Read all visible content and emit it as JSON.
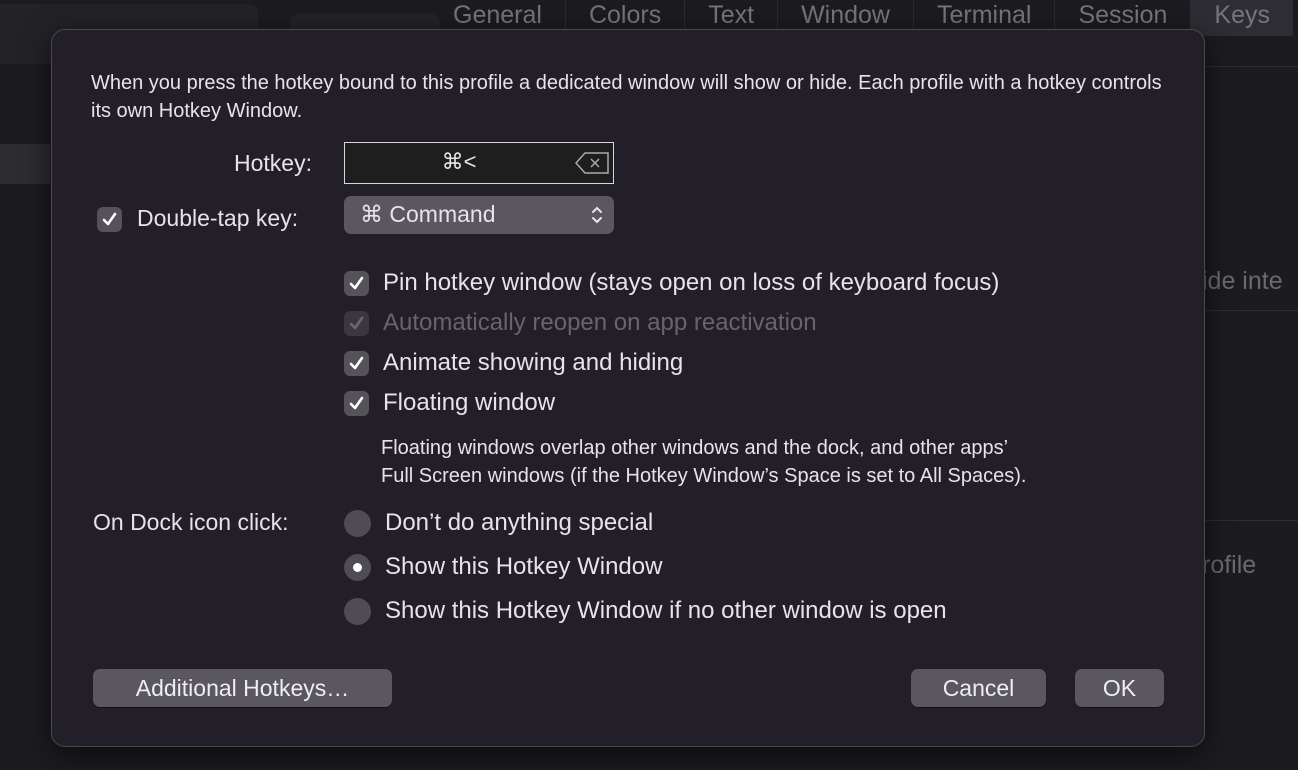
{
  "background": {
    "tabs": [
      "General",
      "Colors",
      "Text",
      "Window",
      "Terminal",
      "Session",
      "Keys"
    ],
    "active_tab": "Keys",
    "partial_text_1": "ide inte",
    "partial_text_2": "rofile"
  },
  "dialog": {
    "description": "When you press the hotkey bound to this profile a dedicated window will show or hide. Each profile with a hotkey controls its own Hotkey Window.",
    "hotkey_label": "Hotkey:",
    "hotkey_value": "⌘<",
    "double_tap_label": "Double-tap key:",
    "double_tap_checked": true,
    "double_tap_value": "⌘ Command",
    "options": [
      {
        "label": "Pin hotkey window (stays open on loss of keyboard focus)",
        "checked": true,
        "enabled": true
      },
      {
        "label": "Automatically reopen on app reactivation",
        "checked": true,
        "enabled": false
      },
      {
        "label": "Animate showing and hiding",
        "checked": true,
        "enabled": true
      },
      {
        "label": "Floating window",
        "checked": true,
        "enabled": true
      }
    ],
    "floating_note_1": "Floating windows overlap other windows and the dock, and other apps’",
    "floating_note_2": "Full Screen windows (if the Hotkey Window’s Space is set to All Spaces).",
    "dock_label": "On Dock icon click:",
    "dock_options": [
      {
        "label": "Don’t do anything special",
        "selected": false
      },
      {
        "label": "Show this Hotkey Window",
        "selected": true
      },
      {
        "label": "Show this Hotkey Window if no other window is open",
        "selected": false
      }
    ],
    "additional_hotkeys": "Additional Hotkeys…",
    "cancel": "Cancel",
    "ok": "OK"
  }
}
